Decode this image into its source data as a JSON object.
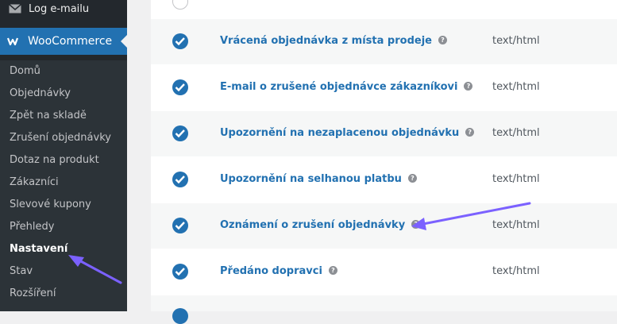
{
  "sidebar": {
    "top_item": {
      "label": "Log e-mailu",
      "icon": "envelope-icon"
    },
    "woocommerce": {
      "label": "WooCommerce",
      "icon": "woocommerce-logo-icon"
    },
    "submenu": [
      {
        "label": "Domů"
      },
      {
        "label": "Objednávky"
      },
      {
        "label": "Zpět na skladě"
      },
      {
        "label": "Zrušení objednávky"
      },
      {
        "label": "Dotaz na produkt"
      },
      {
        "label": "Zákazníci"
      },
      {
        "label": "Slevové kupony"
      },
      {
        "label": "Přehledy"
      },
      {
        "label": "Nastavení",
        "active": true
      },
      {
        "label": "Stav"
      },
      {
        "label": "Rozšíření"
      }
    ]
  },
  "emails": {
    "rows": [
      {
        "name": "Vrácená objednávka z místa prodeje",
        "type": "text/html",
        "enabled": true
      },
      {
        "name": "E-mail o zrušené objednávce zákazníkovi",
        "type": "text/html",
        "enabled": true
      },
      {
        "name": "Upozornění na nezaplacenou objednávku",
        "type": "text/html",
        "enabled": true
      },
      {
        "name": "Upozornění na selhanou platbu",
        "type": "text/html",
        "enabled": true
      },
      {
        "name": "Oznámení o zrušení objednávky",
        "type": "text/html",
        "enabled": true
      },
      {
        "name": "Předáno dopravci",
        "type": "text/html",
        "enabled": true
      }
    ],
    "help_glyph": "?"
  },
  "colors": {
    "sidebar_bg": "#23282d",
    "submenu_bg": "#2c3338",
    "accent": "#2271b1",
    "annotation_arrow": "#7b61ff"
  }
}
